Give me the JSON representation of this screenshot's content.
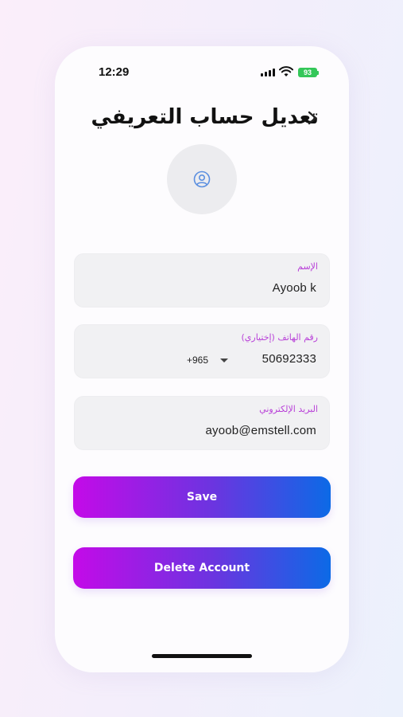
{
  "status_bar": {
    "time": "12:29",
    "battery": "93"
  },
  "header": {
    "title": "تعديل حساب التعريفي"
  },
  "form": {
    "name": {
      "label": "الإسم",
      "value": "Ayoob k"
    },
    "phone": {
      "label": "رقم الهاتف (إختياري)",
      "country_code": "+965",
      "value": "50692333"
    },
    "email": {
      "label": "البريد الإلكتروني",
      "value": "ayoob@emstell.com"
    }
  },
  "actions": {
    "save_label": "Save",
    "delete_label": "Delete Account"
  },
  "colors": {
    "accent_label": "#b83fd8",
    "gradient_start": "#c40ae8",
    "gradient_end": "#0c6ae6",
    "battery": "#34c759"
  },
  "icons": {
    "back": "back-arrow-icon",
    "avatar": "user-circle-icon",
    "signal": "cellular-signal-icon",
    "wifi": "wifi-icon",
    "battery": "battery-icon"
  }
}
